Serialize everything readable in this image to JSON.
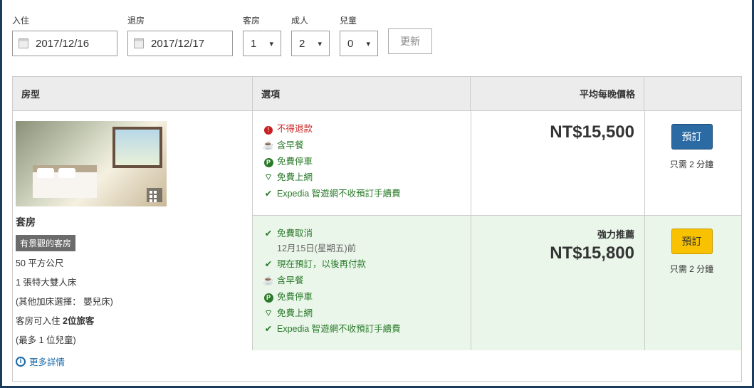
{
  "search": {
    "checkin_label": "入住",
    "checkout_label": "退房",
    "rooms_label": "客房",
    "adults_label": "成人",
    "children_label": "兒童",
    "checkin": "2017/12/16",
    "checkout": "2017/12/17",
    "rooms": "1",
    "adults": "2",
    "children": "0",
    "update": "更新"
  },
  "headers": {
    "room": "房型",
    "option": "選項",
    "price": "平均每晚價格"
  },
  "room": {
    "name": "套房",
    "tag": "有景觀的客房",
    "size": "50 平方公尺",
    "bed": "1 張特大雙人床",
    "extra": "(其他加床選擇：  嬰兒床)",
    "occupancy_prefix": "客房可入住 ",
    "occupancy_bold": "2位旅客",
    "occupancy_note": "(最多 1 位兒童)",
    "more": "更多詳情"
  },
  "offers": [
    {
      "features": [
        {
          "icon": "info-icon",
          "style": "red",
          "text": "不得退款"
        },
        {
          "icon": "cup-icon",
          "style": "green-text",
          "text": "含早餐"
        },
        {
          "icon": "parking-icon",
          "style": "green-text",
          "text": "免費停車"
        },
        {
          "icon": "wifi-icon",
          "style": "green-text",
          "text": "免費上網"
        },
        {
          "icon": "check-icon",
          "style": "green-text",
          "text": "Expedia 智遊網不收預訂手續費"
        }
      ],
      "price": "NT$15,500",
      "reco": "",
      "book": "預訂",
      "book_style": "blue",
      "note": "只需 2 分鐘"
    },
    {
      "features": [
        {
          "icon": "check-icon",
          "style": "green-text",
          "text": "免費取消",
          "sub": "12月15日(星期五)前"
        },
        {
          "icon": "check-icon",
          "style": "green-text",
          "text": "現在預訂，以後再付款"
        },
        {
          "icon": "cup-icon",
          "style": "green-text",
          "text": "含早餐"
        },
        {
          "icon": "parking-icon",
          "style": "green-text",
          "text": "免費停車"
        },
        {
          "icon": "wifi-icon",
          "style": "green-text",
          "text": "免費上網"
        },
        {
          "icon": "check-icon",
          "style": "green-text",
          "text": "Expedia 智遊網不收預訂手續費"
        }
      ],
      "price": "NT$15,800",
      "reco": "強力推薦",
      "book": "預訂",
      "book_style": "yellow",
      "note": "只需 2 分鐘"
    }
  ]
}
